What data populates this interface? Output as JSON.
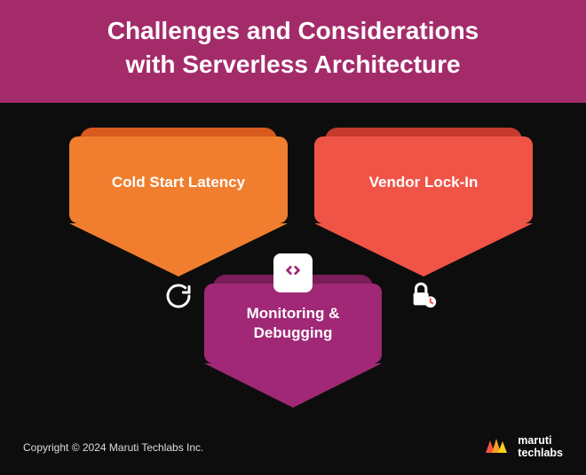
{
  "header": {
    "title_line1": "Challenges and Considerations",
    "title_line2": "with Serverless Architecture"
  },
  "cards": {
    "left": {
      "label": "Cold Start Latency",
      "icon": "refresh-icon",
      "color": "orange"
    },
    "right": {
      "label": "Vendor Lock-In",
      "icon": "lock-clock-icon",
      "color": "red"
    },
    "center": {
      "label": "Monitoring & Debugging",
      "icon": "code-icon",
      "color": "magenta"
    }
  },
  "footer": {
    "copyright": "Copyright © 2024 Maruti Techlabs Inc.",
    "brand_line1": "maruti",
    "brand_line2": "techlabs"
  },
  "colors": {
    "header_bg": "#a42b6a",
    "page_bg": "#0d0d0d",
    "orange": "#f07e2e",
    "red": "#f05446",
    "magenta": "#a02876"
  }
}
